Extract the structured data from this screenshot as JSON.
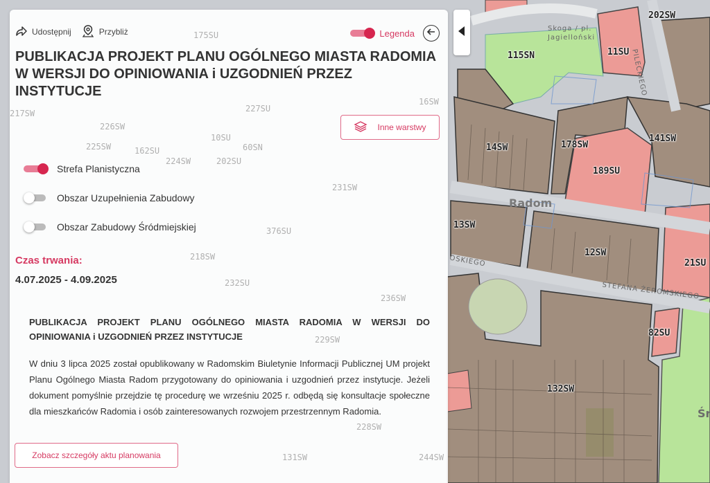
{
  "toolbar": {
    "share_label": "Udostępnij",
    "zoom_label": "Przybliż",
    "legend_label": "Legenda",
    "legend_on": true
  },
  "panel": {
    "title": "PUBLIKACJA PROJEKT PLANU OGÓLNEGO MIASTA RADOMIA W WERSJI DO OPINIOWANIA i UZGODNIEŃ PRZEZ INSTYTUCJE",
    "other_layers_label": "Inne warstwy",
    "layers": [
      {
        "label": "Strefa Planistyczna",
        "on": true
      },
      {
        "label": "Obszar Uzupełnienia Zabudowy",
        "on": false
      },
      {
        "label": "Obszar Zabudowy Śródmiejskiej",
        "on": false
      }
    ],
    "duration_label": "Czas trwania:",
    "duration_value": "4.07.2025 - 4.09.2025",
    "description_title": "PUBLIKACJA PROJEKT PLANU OGÓLNEGO MIASTA RADOMIA W WERSJI DO OPINIOWANIA i UZGODNIEŃ PRZEZ INSTYTUCJE",
    "description_body": "W dniu 3 lipca 2025 został opublikowany w Radomskim Biuletynie Informacji Publicznej UM projekt Planu Ogólnego Miasta Radom przygotowany do opiniowania i uzgodnień przez instytucje. Jeżeli dokument pomyślnie przejdzie tę procedurę we wrześniu 2025 r. odbędą się konsultacje społeczne dla mieszkańców Radomia i osób zainteresowanych rozwojem przestrzennym Radomia.",
    "details_button_label": "Zobacz szczegóły aktu planowania"
  },
  "map": {
    "zone_labels": [
      "202SW",
      "11SU",
      "115SN",
      "141SW",
      "178SW",
      "189SU",
      "14SW",
      "13SW",
      "12SW",
      "21SU",
      "82SU",
      "132SW"
    ],
    "faint_labels": [
      "175SU",
      "227SU",
      "226SW",
      "217SW",
      "225SW",
      "162SU",
      "224SW",
      "10SU",
      "60SN",
      "202SU",
      "231SW",
      "376SU",
      "218SW",
      "232SU",
      "236SW",
      "229SW",
      "228SW",
      "131SW",
      "244SW",
      "16SW"
    ],
    "street_labels": [
      "Skoga / pl. Jagielloński",
      "STEFANA ŻEROMSKIEGO",
      "PILECKIEGO",
      "OSKIEGO",
      "Śród"
    ],
    "city_label": "Radom",
    "colors": {
      "brown_zone": "#a18e7e",
      "pink_zone": "#ec9b96",
      "green_zone": "#b8e49a",
      "road": "#c8cbcf",
      "accent": "#d63a62"
    }
  }
}
